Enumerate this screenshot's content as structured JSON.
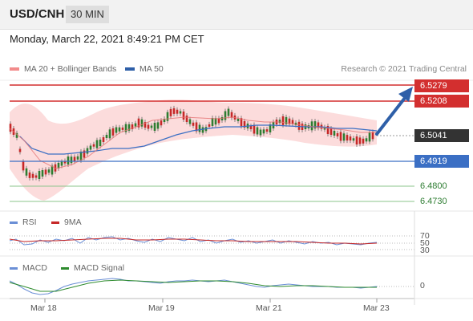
{
  "header": {
    "symbol": "USD/CNH",
    "timeframe": "30 MIN"
  },
  "datetime": "Monday, March 22, 2021 8:49:21 PM CET",
  "legend": {
    "bollinger_label": "MA 20 + Bollinger Bands",
    "ma50_label": "MA 50",
    "credit": "Research © 2021 Trading Central",
    "rsi_label": "RSI",
    "rsi_ma_label": "9MA",
    "macd_label": "MACD",
    "macd_signal_label": "MACD Signal"
  },
  "colors": {
    "resistance": "#d32f2f",
    "support": "#3b6fc4",
    "target": "#66a866",
    "last": "#333333",
    "candle_up": "#2e7d32",
    "candle_down": "#c62828",
    "band": "#f8c8c8",
    "ma50": "#3b6fc4",
    "arrow": "#2e5fa8"
  },
  "levels": [
    {
      "id": "r2",
      "label": "6.5279",
      "kind": "resistance"
    },
    {
      "id": "r1",
      "label": "6.5208",
      "kind": "resistance"
    },
    {
      "id": "last",
      "label": "6.5041",
      "kind": "last"
    },
    {
      "id": "s1",
      "label": "6.4919",
      "kind": "support"
    },
    {
      "id": "t1",
      "label": "6.4800",
      "kind": "target"
    },
    {
      "id": "t2",
      "label": "6.4730",
      "kind": "target"
    }
  ],
  "rsi_levels": [
    "70",
    "50",
    "30"
  ],
  "macd_zero": "0",
  "x_axis": [
    "Mar 18",
    "Mar 19",
    "Mar 21",
    "Mar 23"
  ]
}
